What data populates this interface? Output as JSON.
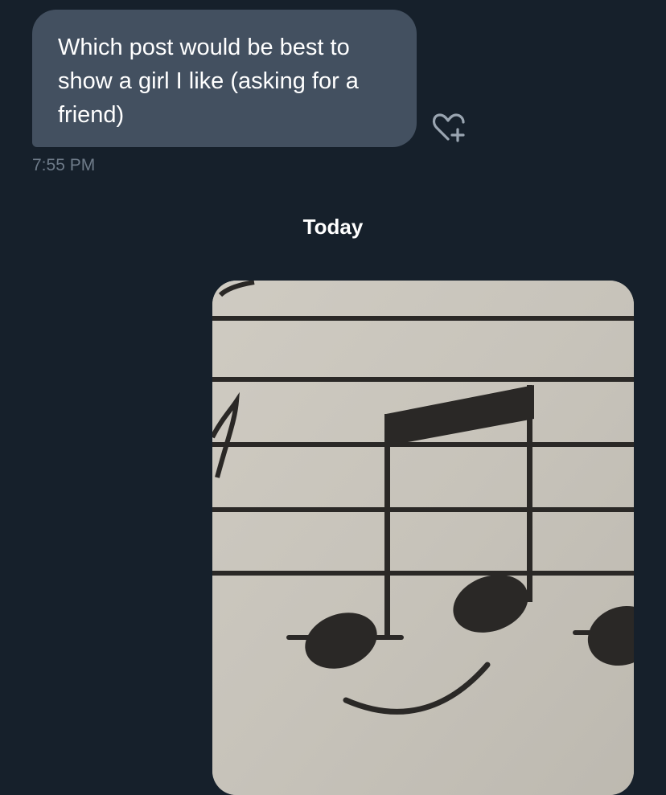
{
  "conversation": {
    "message": {
      "text": "Which post would be best to show a girl I like (asking for a friend)",
      "time": "7:55 PM"
    },
    "like_icon": "heart-plus-icon",
    "date_separator": "Today",
    "attachment": {
      "type": "image",
      "description_icon": "sheet-music-smiley-image"
    }
  },
  "colors": {
    "background": "#16202b",
    "bubble": "#435060",
    "timestamp": "#6e7b89",
    "text": "#ffffff",
    "paper": "#c8c4bb",
    "ink": "#2a2826"
  }
}
